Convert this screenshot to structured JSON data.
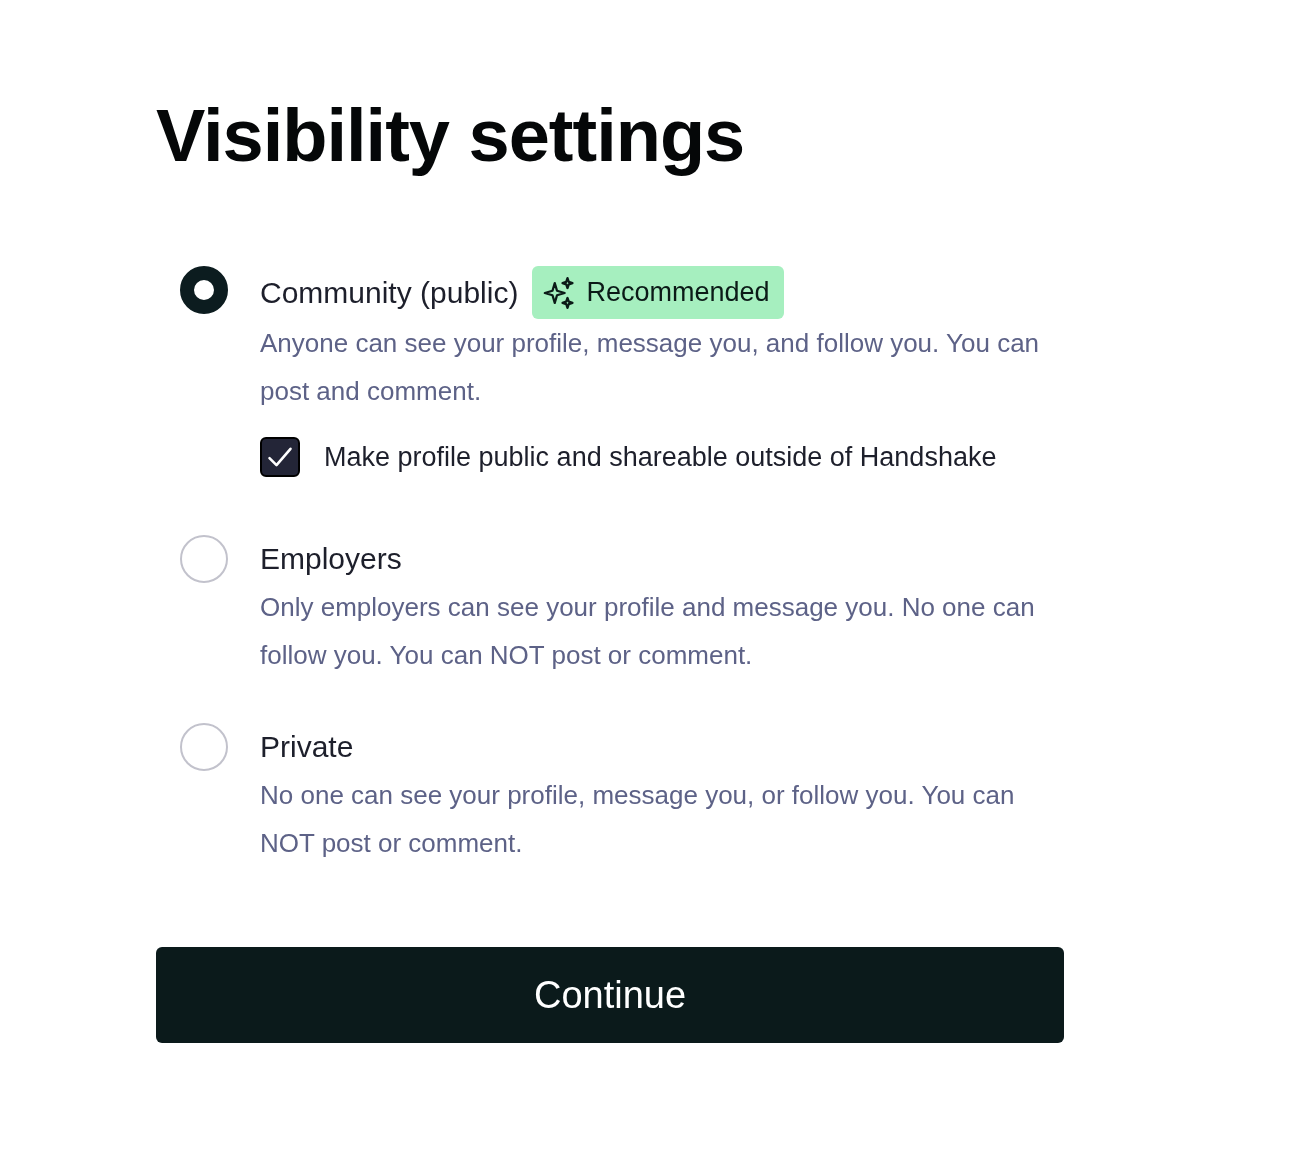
{
  "title": "Visibility settings",
  "options": [
    {
      "label": "Community (public)",
      "selected": true,
      "badge": "Recommended",
      "description": "Anyone can see your profile, message you, and follow you. You can post and comment.",
      "checkbox": {
        "label": "Make profile public and shareable outside of Handshake",
        "checked": true
      }
    },
    {
      "label": "Employers",
      "selected": false,
      "description": "Only employers can see your profile and message you. No one can follow you. You can NOT post or comment."
    },
    {
      "label": "Private",
      "selected": false,
      "description": "No one can see your profile, message you, or follow you. You can NOT post or comment."
    }
  ],
  "button": "Continue"
}
